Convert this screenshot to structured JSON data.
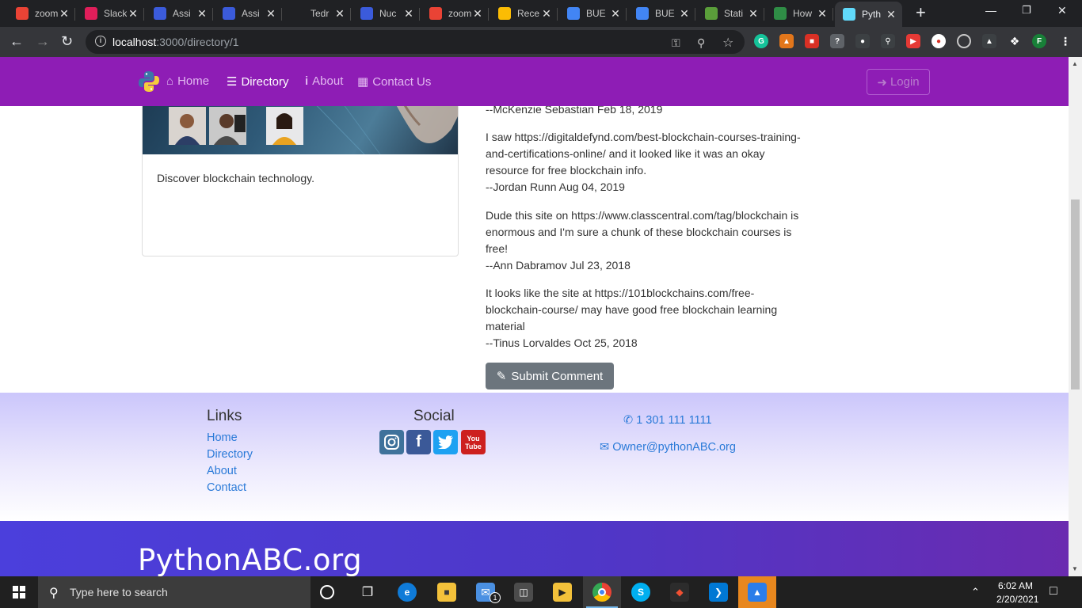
{
  "browser": {
    "tabs": [
      {
        "title": "zoom",
        "icon": "gmail-icon",
        "color": "#ea4335"
      },
      {
        "title": "Slack",
        "icon": "slack-icon",
        "color": "#e01e5a"
      },
      {
        "title": "Assi",
        "icon": "assignment-icon",
        "color": "#3b5bdb"
      },
      {
        "title": "Assi",
        "icon": "assignment-icon",
        "color": "#3b5bdb"
      },
      {
        "title": "Tedr",
        "icon": "github-icon",
        "color": "#202124"
      },
      {
        "title": "Nuc",
        "icon": "assignment-icon",
        "color": "#3b5bdb"
      },
      {
        "title": "zoom",
        "icon": "gmail-icon",
        "color": "#ea4335"
      },
      {
        "title": "Rece",
        "icon": "drive-icon",
        "color": "#fbbc04"
      },
      {
        "title": "BUE",
        "icon": "docs-icon",
        "color": "#4285f4"
      },
      {
        "title": "BUE",
        "icon": "docs-icon",
        "color": "#4285f4"
      },
      {
        "title": "Stati",
        "icon": "blockchain-icon",
        "color": "#5a9e3a"
      },
      {
        "title": "How",
        "icon": "geeks-icon",
        "color": "#2f8d46"
      },
      {
        "title": "Pyth",
        "icon": "react-icon",
        "color": "#61dafb"
      }
    ],
    "url_host": "localhost",
    "url_path": ":3000/directory/1"
  },
  "nav": {
    "home": "Home",
    "directory": "Directory",
    "about": "About",
    "contact": "Contact Us",
    "login": "Login"
  },
  "card": {
    "text": "Discover blockchain technology."
  },
  "comments": [
    {
      "text": "",
      "author": "--McKenzie Sebastian Feb 18, 2019"
    },
    {
      "text": "I saw https://digitaldefynd.com/best-blockchain-courses-training-and-certifications-online/ and it looked like it was an okay resource for free blockchain info.",
      "author": "--Jordan Runn Aug 04, 2019"
    },
    {
      "text": "Dude this site on https://www.classcentral.com/tag/blockchain is enormous and I'm sure a chunk of these blockchain courses is free!",
      "author": "--Ann Dabramov Jul 23, 2018"
    },
    {
      "text": "It looks like the site at https://101blockchains.com/free-blockchain-course/ may have good free blockchain learning material",
      "author": "--Tinus Lorvaldes Oct 25, 2018"
    }
  ],
  "submit_label": "Submit Comment",
  "footer": {
    "links_heading": "Links",
    "links": [
      "Home",
      "Directory",
      "About",
      "Contact"
    ],
    "social_heading": "Social",
    "social": [
      {
        "name": "instagram",
        "color": "#3f729b"
      },
      {
        "name": "facebook",
        "color": "#3b5998"
      },
      {
        "name": "twitter",
        "color": "#1da1f2"
      },
      {
        "name": "youtube",
        "color": "#cd201f"
      }
    ],
    "phone": "1 301 111 1111",
    "email": "Owner@pythonABC.org"
  },
  "banner": "PythonABC.org",
  "taskbar": {
    "search_placeholder": "Type here to search",
    "time": "6:02 AM",
    "date": "2/20/2021",
    "mail_badge": "1"
  },
  "profile_initial": "F"
}
